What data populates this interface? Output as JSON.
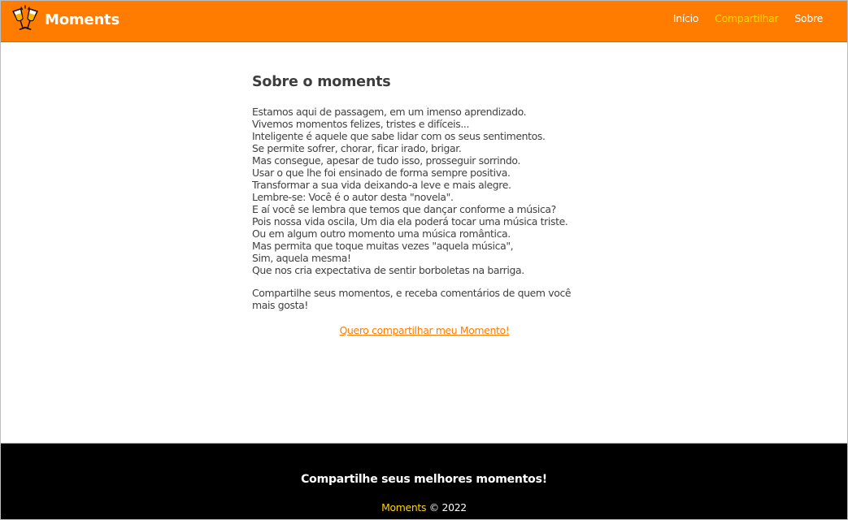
{
  "navbar": {
    "brand_name": "Moments",
    "logo_icon": "champagne-toast-icon",
    "links": [
      {
        "label": "Início",
        "active": false
      },
      {
        "label": "Compartilhar",
        "active": true
      },
      {
        "label": "Sobre",
        "active": false
      }
    ]
  },
  "main": {
    "title": "Sobre o moments",
    "poem_lines": [
      "Estamos aqui de passagem, em um imenso aprendizado.",
      "Vivemos momentos felizes, tristes e difíceis...",
      "Inteligente é aquele que sabe lidar com os seus sentimentos.",
      "Se permite sofrer, chorar, ficar irado, brigar.",
      "Mas consegue, apesar de tudo isso, prosseguir sorrindo.",
      "Usar o que lhe foi ensinado de forma sempre positiva.",
      "Transformar a sua vida deixando-a leve e mais alegre.",
      "Lembre-se: Você é o autor desta \"novela\".",
      "E aí você se lembra que temos que dançar conforme a música?",
      "Pois nossa vida oscila, Um dia ela poderá tocar uma música triste.",
      "Ou em algum outro momento uma música romântica.",
      "Mas permita que toque muitas vezes \"aquela música\",",
      "Sim, aquela mesma!",
      "Que nos cria expectativa de sentir borboletas na barriga."
    ],
    "invite": "Compartilhe seus momentos, e receba comentários de quem você mais gosta!",
    "cta_label": "Quero compartilhar meu Momento!"
  },
  "footer": {
    "tagline": "Compartilhe seus melhores momentos!",
    "brand": "Moments",
    "copyright": "© 2022"
  },
  "colors": {
    "navbar_bg": "#ff7c00",
    "active_link": "#ffd400",
    "footer_bg": "#000000",
    "cta_link": "#ff7c00"
  }
}
